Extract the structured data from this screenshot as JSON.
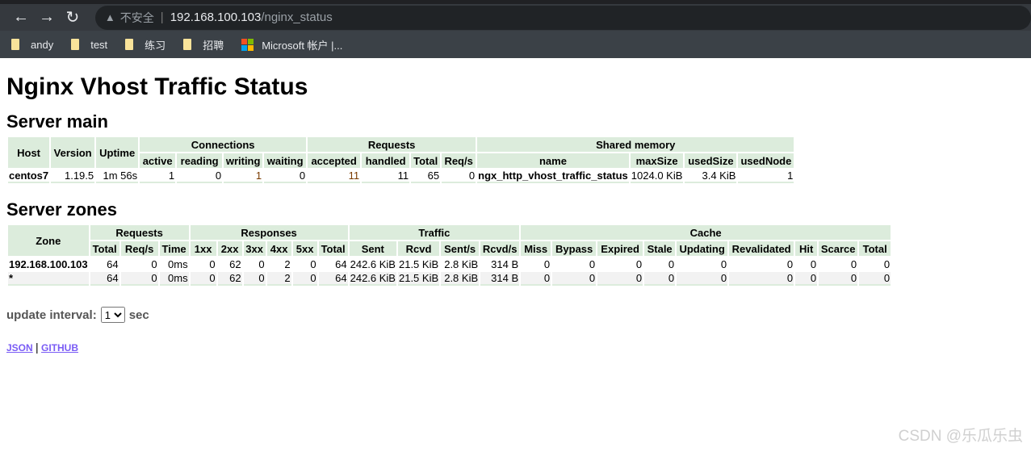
{
  "browser": {
    "back": "←",
    "forward": "→",
    "reload": "↻",
    "security_label": "不安全",
    "url_host": "192.168.100.103",
    "url_path": "/nginx_status",
    "bookmarks": [
      {
        "label": "andy",
        "icon": "folder"
      },
      {
        "label": "test",
        "icon": "folder"
      },
      {
        "label": "练习",
        "icon": "folder"
      },
      {
        "label": "招聘",
        "icon": "folder"
      },
      {
        "label": "Microsoft 帐户 |...",
        "icon": "microsoft-logo"
      }
    ]
  },
  "title": "Nginx Vhost Traffic Status",
  "server_main": {
    "heading": "Server main",
    "groups": [
      {
        "label": "Host",
        "span": 1,
        "rows": 2
      },
      {
        "label": "Version",
        "span": 1,
        "rows": 2
      },
      {
        "label": "Uptime",
        "span": 1,
        "rows": 2
      },
      {
        "label": "Connections",
        "span": 4
      },
      {
        "label": "Requests",
        "span": 4
      },
      {
        "label": "Shared memory",
        "span": 4
      }
    ],
    "columns": [
      "active",
      "reading",
      "writing",
      "waiting",
      "accepted",
      "handled",
      "Total",
      "Req/s",
      "name",
      "maxSize",
      "usedSize",
      "usedNode"
    ],
    "rows": [
      [
        "centos7",
        "1.19.5",
        "1m 56s",
        "1",
        "0",
        "1",
        "0",
        "11",
        "11",
        "65",
        "0",
        "ngx_http_vhost_traffic_status",
        "1024.0 KiB",
        "3.4 KiB",
        "1"
      ]
    ]
  },
  "server_zones": {
    "heading": "Server zones",
    "groups": [
      {
        "label": "Zone",
        "span": 1,
        "rows": 2
      },
      {
        "label": "Requests",
        "span": 3
      },
      {
        "label": "Responses",
        "span": 6
      },
      {
        "label": "Traffic",
        "span": 4
      },
      {
        "label": "Cache",
        "span": 9
      }
    ],
    "columns": [
      "Total",
      "Req/s",
      "Time",
      "1xx",
      "2xx",
      "3xx",
      "4xx",
      "5xx",
      "Total",
      "Sent",
      "Rcvd",
      "Sent/s",
      "Rcvd/s",
      "Miss",
      "Bypass",
      "Expired",
      "Stale",
      "Updating",
      "Revalidated",
      "Hit",
      "Scarce",
      "Total"
    ],
    "rows": [
      [
        "192.168.100.103",
        "64",
        "0",
        "0ms",
        "0",
        "62",
        "0",
        "2",
        "0",
        "64",
        "242.6 KiB",
        "21.5 KiB",
        "2.8 KiB",
        "314 B",
        "0",
        "0",
        "0",
        "0",
        "0",
        "0",
        "0",
        "0",
        "0"
      ],
      [
        "*",
        "64",
        "0",
        "0ms",
        "0",
        "62",
        "0",
        "2",
        "0",
        "64",
        "242.6 KiB",
        "21.5 KiB",
        "2.8 KiB",
        "314 B",
        "0",
        "0",
        "0",
        "0",
        "0",
        "0",
        "0",
        "0",
        "0"
      ]
    ]
  },
  "update": {
    "label": "update interval:",
    "value": "1",
    "unit": "sec"
  },
  "links": {
    "json": "JSON",
    "separator": "|",
    "github": "GITHUB"
  },
  "watermark": "CSDN @乐瓜乐虫",
  "colors": {
    "header_bg": "#dcecdc",
    "link": "#7a5cf5"
  }
}
